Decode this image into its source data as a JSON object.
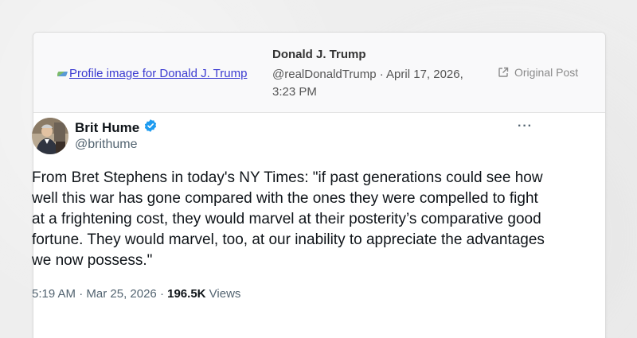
{
  "header": {
    "profile_image_alt": "Profile image for Donald J. Trump",
    "author_name": "Donald J. Trump",
    "author_meta": "@realDonaldTrump · April 17, 2026, 3:23 PM",
    "original_post_label": "Original Post",
    "original_post_icon": "external-link-icon"
  },
  "tweet": {
    "display_name": "Brit Hume",
    "verified_icon": "verified-badge-icon",
    "handle": "@brithume",
    "more_label": "···",
    "text": "From Bret Stephens in today's NY Times: \"if past generations could see how well this war has gone compared with the ones they were compelled to fight at a frightening cost, they would marvel at their posterity’s comparative good fortune. They would marvel, too, at our inability to appreciate the advantages we now possess.\"",
    "time": "5:19 AM",
    "date": "Mar 25, 2026",
    "separator": " · ",
    "views_count": "196.5K",
    "views_label": "Views"
  },
  "colors": {
    "verified": "#1d9bf0",
    "link": "#3b3bd1"
  }
}
